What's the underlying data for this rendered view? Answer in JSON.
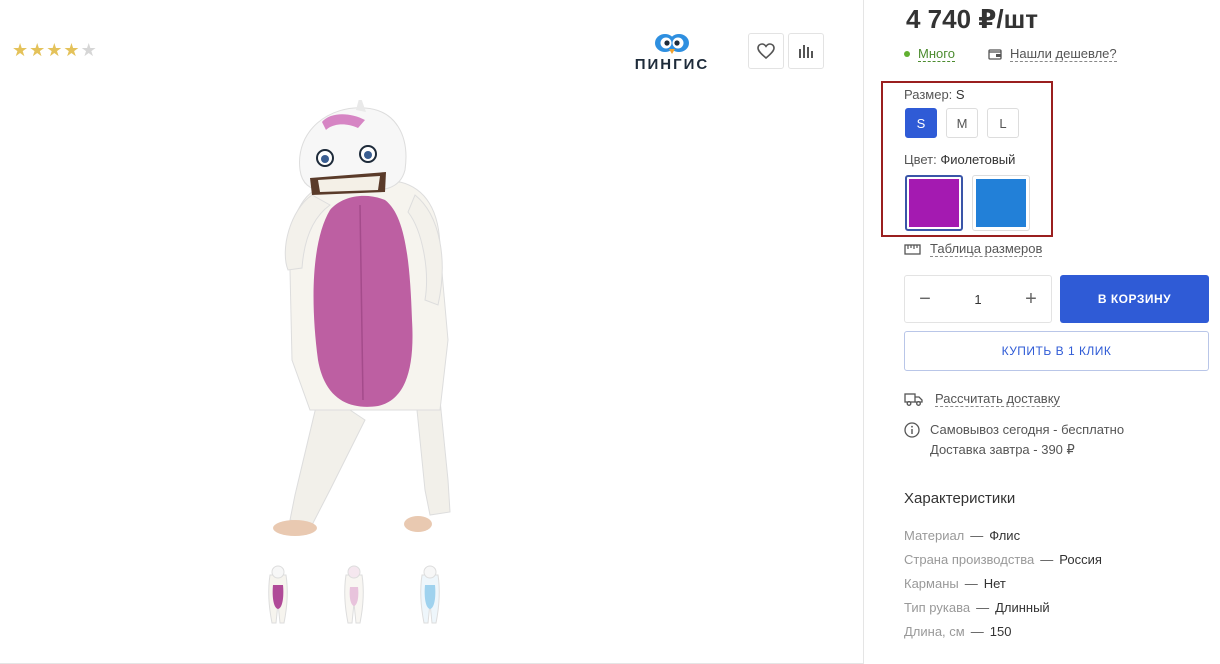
{
  "product": {
    "rating_stars": [
      "★",
      "★",
      "★",
      "★",
      "★"
    ],
    "brand_name": "ПИНГИС"
  },
  "buy": {
    "price": "4 740 ₽/шт",
    "stock": "Много",
    "cheaper": "Нашли дешевле?",
    "size_label": "Размер:",
    "size_value": "S",
    "sizes": [
      "S",
      "M",
      "L"
    ],
    "color_label": "Цвет:",
    "color_value": "Фиолетовый",
    "colors": [
      "#a41ab1",
      "#2280d8"
    ],
    "size_table": "Таблица размеров",
    "qty_minus": "−",
    "qty_value": "1",
    "qty_plus": "+",
    "cart_button": "В КОРЗИНУ",
    "one_click_button": "КУПИТЬ В 1 КЛИК"
  },
  "delivery": {
    "calc_link": "Рассчитать доставку",
    "pickup": "Самовывоз сегодня - бесплатно",
    "courier": "Доставка завтра - 390 ₽"
  },
  "characteristics": {
    "title": "Характеристики",
    "separator": "—",
    "rows": [
      {
        "key": "Материал",
        "value": "Флис"
      },
      {
        "key": "Страна производства",
        "value": "Россия"
      },
      {
        "key": "Карманы",
        "value": "Нет"
      },
      {
        "key": "Тип рукава",
        "value": "Длинный"
      },
      {
        "key": "Длина, см",
        "value": "150"
      }
    ]
  },
  "colors": {
    "accent": "#2f5bd6",
    "star": "#e4c25a",
    "stock_green": "#61b030",
    "highlight_border": "#9a1f1f"
  }
}
